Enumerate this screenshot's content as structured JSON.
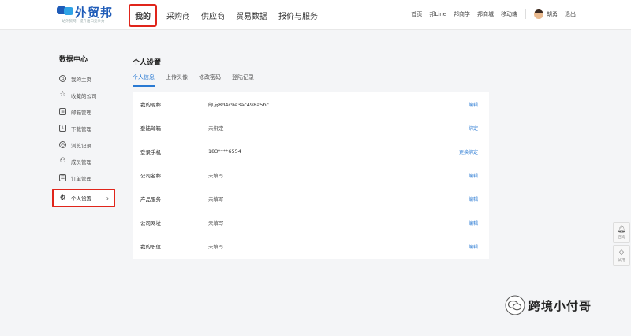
{
  "header": {
    "logo_text": "外贸邦",
    "logo_slogan": "一站外贸网，提升出口竞争力",
    "main_nav": [
      "我的",
      "采购商",
      "供应商",
      "贸易数据",
      "报价与服务"
    ],
    "right_nav": [
      "首页",
      "邦Line",
      "邦商学",
      "邦商城",
      "移动端"
    ],
    "user_name": "胡勇",
    "logout": "退出"
  },
  "sidebar": {
    "title": "数据中心",
    "items": [
      {
        "label": "我的主页",
        "icon": "home-icon"
      },
      {
        "label": "收藏的公司",
        "icon": "star-icon"
      },
      {
        "label": "邮箱管理",
        "icon": "mail-icon"
      },
      {
        "label": "下载管理",
        "icon": "download-icon"
      },
      {
        "label": "浏览记录",
        "icon": "clock-icon"
      },
      {
        "label": "成员管理",
        "icon": "member-icon"
      },
      {
        "label": "订单管理",
        "icon": "order-icon"
      },
      {
        "label": "个人设置",
        "icon": "gear-icon"
      }
    ]
  },
  "content": {
    "title": "个人设置",
    "tabs": [
      "个人信息",
      "上传头像",
      "修改密码",
      "登陆记录"
    ],
    "rows": [
      {
        "label": "我的昵称",
        "value": "邮友8d4c9e3ac498a5bc",
        "action": "编辑"
      },
      {
        "label": "登陆邮箱",
        "value": "未绑定",
        "action": "绑定"
      },
      {
        "label": "登录手机",
        "value": "183****6554",
        "action": "更换绑定"
      },
      {
        "label": "公司名称",
        "value": "未填写",
        "action": "编辑"
      },
      {
        "label": "产品服务",
        "value": "未填写",
        "action": "编辑"
      },
      {
        "label": "公司网址",
        "value": "未填写",
        "action": "编辑"
      },
      {
        "label": "我的职位",
        "value": "未填写",
        "action": "编辑"
      }
    ]
  },
  "float": {
    "consult": "咨询",
    "vip": "试用"
  },
  "watermark": "跨境小付哥"
}
